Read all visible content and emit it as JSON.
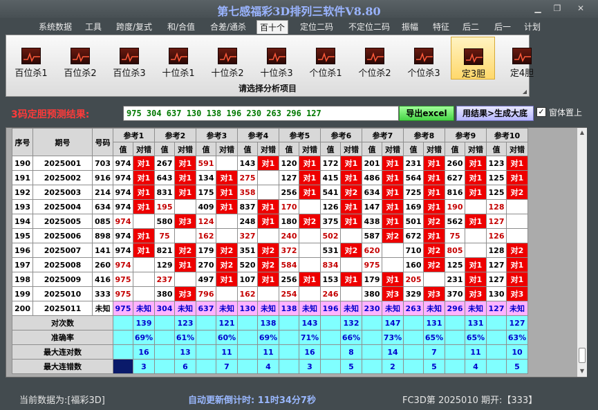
{
  "window": {
    "title": "第七感福彩3D排列三软件V8.80",
    "minimize": "▁",
    "restore": "❐",
    "close": "✕"
  },
  "menu": [
    {
      "label": "系统数据"
    },
    {
      "label": "工具"
    },
    {
      "label": "跨度/复式"
    },
    {
      "label": "和/合值"
    },
    {
      "label": "合差/通杀"
    },
    {
      "label": "百十个"
    },
    {
      "label": "定位二码"
    },
    {
      "label": "不定位二码"
    },
    {
      "label": "振幅"
    },
    {
      "label": "特征"
    },
    {
      "label": "后二"
    },
    {
      "label": "后一"
    },
    {
      "label": "计划"
    }
  ],
  "menu_active": "百十个",
  "ribbon": {
    "buttons": [
      {
        "label": "百位杀1"
      },
      {
        "label": "百位杀2"
      },
      {
        "label": "百位杀3"
      },
      {
        "label": "十位杀1"
      },
      {
        "label": "十位杀2"
      },
      {
        "label": "十位杀3"
      },
      {
        "label": "个位杀1"
      },
      {
        "label": "个位杀2"
      },
      {
        "label": "个位杀3"
      },
      {
        "label": "定3胆"
      },
      {
        "label": "定4胆"
      }
    ],
    "active": "定3胆",
    "caption": "请选择分析项目",
    "icon": "chart-icon"
  },
  "result": {
    "label": "3码定胆预测结果:",
    "value": "975 304 637 130 138 196 230 263 296 127",
    "excel_button": "导出excel",
    "generate_button": "用结果>生成大底",
    "topmost_checked": "✓",
    "topmost_label": "窗体置上"
  },
  "table": {
    "col_seq": "序号",
    "col_issue": "期号",
    "col_number": "号码",
    "ref_headers": [
      "参考1",
      "参考2",
      "参考3",
      "参考4",
      "参考5",
      "参考6",
      "参考7",
      "参考8",
      "参考9",
      "参考10"
    ],
    "sub_value": "值",
    "sub_hit": "对错",
    "rows": [
      {
        "seq": "190",
        "issue": "2025001",
        "number": "703",
        "refs": [
          [
            "974",
            "对1"
          ],
          [
            "267",
            "对1"
          ],
          [
            "591",
            ""
          ],
          [
            "143",
            "对1"
          ],
          [
            "120",
            "对1"
          ],
          [
            "172",
            "对1"
          ],
          [
            "201",
            "对1"
          ],
          [
            "231",
            "对1"
          ],
          [
            "260",
            "对1"
          ],
          [
            "123",
            "对1"
          ]
        ]
      },
      {
        "seq": "191",
        "issue": "2025002",
        "number": "916",
        "refs": [
          [
            "974",
            "对1"
          ],
          [
            "643",
            "对1"
          ],
          [
            "134",
            "对1"
          ],
          [
            "275",
            ""
          ],
          [
            "127",
            "对1"
          ],
          [
            "415",
            "对1"
          ],
          [
            "486",
            "对1"
          ],
          [
            "564",
            "对1"
          ],
          [
            "627",
            "对1"
          ],
          [
            "125",
            "对1"
          ]
        ]
      },
      {
        "seq": "192",
        "issue": "2025003",
        "number": "214",
        "refs": [
          [
            "974",
            "对1"
          ],
          [
            "831",
            "对1"
          ],
          [
            "175",
            "对1"
          ],
          [
            "358",
            ""
          ],
          [
            "256",
            "对1"
          ],
          [
            "541",
            "对2"
          ],
          [
            "634",
            "对1"
          ],
          [
            "725",
            "对1"
          ],
          [
            "816",
            "对1"
          ],
          [
            "125",
            "对2"
          ]
        ]
      },
      {
        "seq": "193",
        "issue": "2025004",
        "number": "634",
        "refs": [
          [
            "974",
            "对1"
          ],
          [
            "195",
            ""
          ],
          [
            "409",
            "对1"
          ],
          [
            "837",
            "对1"
          ],
          [
            "170",
            ""
          ],
          [
            "126",
            "对1"
          ],
          [
            "147",
            "对1"
          ],
          [
            "169",
            "对1"
          ],
          [
            "190",
            ""
          ],
          [
            "128",
            ""
          ]
        ]
      },
      {
        "seq": "194",
        "issue": "2025005",
        "number": "085",
        "refs": [
          [
            "974",
            ""
          ],
          [
            "580",
            "对3"
          ],
          [
            "124",
            ""
          ],
          [
            "248",
            "对1"
          ],
          [
            "180",
            "对2"
          ],
          [
            "375",
            "对1"
          ],
          [
            "438",
            "对1"
          ],
          [
            "501",
            "对2"
          ],
          [
            "562",
            "对1"
          ],
          [
            "127",
            ""
          ]
        ]
      },
      {
        "seq": "195",
        "issue": "2025006",
        "number": "898",
        "refs": [
          [
            "974",
            "对1"
          ],
          [
            "75",
            ""
          ],
          [
            "162",
            ""
          ],
          [
            "327",
            ""
          ],
          [
            "240",
            ""
          ],
          [
            "502",
            ""
          ],
          [
            "587",
            "对2"
          ],
          [
            "672",
            "对1"
          ],
          [
            "75",
            ""
          ],
          [
            "126",
            ""
          ]
        ]
      },
      {
        "seq": "196",
        "issue": "2025007",
        "number": "141",
        "refs": [
          [
            "974",
            "对1"
          ],
          [
            "821",
            "对2"
          ],
          [
            "179",
            "对2"
          ],
          [
            "351",
            "对2"
          ],
          [
            "372",
            ""
          ],
          [
            "531",
            "对2"
          ],
          [
            "620",
            ""
          ],
          [
            "710",
            "对2"
          ],
          [
            "805",
            ""
          ],
          [
            "128",
            "对2"
          ]
        ]
      },
      {
        "seq": "197",
        "issue": "2025008",
        "number": "260",
        "refs": [
          [
            "974",
            ""
          ],
          [
            "129",
            "对1"
          ],
          [
            "270",
            "对2"
          ],
          [
            "520",
            "对2"
          ],
          [
            "584",
            ""
          ],
          [
            "834",
            ""
          ],
          [
            "975",
            ""
          ],
          [
            "160",
            "对2"
          ],
          [
            "125",
            "对1"
          ],
          [
            "127",
            "对1"
          ]
        ]
      },
      {
        "seq": "198",
        "issue": "2025009",
        "number": "416",
        "refs": [
          [
            "975",
            ""
          ],
          [
            "237",
            ""
          ],
          [
            "497",
            "对1"
          ],
          [
            "107",
            "对1"
          ],
          [
            "256",
            "对1"
          ],
          [
            "153",
            "对1"
          ],
          [
            "179",
            "对1"
          ],
          [
            "205",
            ""
          ],
          [
            "231",
            "对1"
          ],
          [
            "127",
            "对1"
          ]
        ]
      },
      {
        "seq": "199",
        "issue": "2025010",
        "number": "333",
        "refs": [
          [
            "975",
            ""
          ],
          [
            "380",
            "对3"
          ],
          [
            "796",
            ""
          ],
          [
            "162",
            ""
          ],
          [
            "254",
            ""
          ],
          [
            "246",
            ""
          ],
          [
            "380",
            "对3"
          ],
          [
            "329",
            "对3"
          ],
          [
            "370",
            "对3"
          ],
          [
            "130",
            "对3"
          ]
        ]
      }
    ],
    "prediction": {
      "seq": "200",
      "issue": "2025011",
      "number": "未知",
      "values": [
        "975",
        "304",
        "637",
        "130",
        "138",
        "196",
        "230",
        "263",
        "296",
        "127"
      ],
      "unknown": "未知"
    },
    "stats": [
      {
        "label": "对次数",
        "values": [
          "139",
          "123",
          "121",
          "138",
          "143",
          "132",
          "147",
          "131",
          "131",
          "127"
        ]
      },
      {
        "label": "准确率",
        "values": [
          "69%",
          "61%",
          "60%",
          "69%",
          "71%",
          "66%",
          "73%",
          "65%",
          "65%",
          "63%"
        ]
      },
      {
        "label": "最大连对数",
        "values": [
          "16",
          "13",
          "11",
          "11",
          "16",
          "8",
          "14",
          "7",
          "11",
          "10"
        ]
      },
      {
        "label": "最大连错数",
        "values": [
          "3",
          "6",
          "7",
          "4",
          "3",
          "5",
          "2",
          "5",
          "4",
          "5"
        ]
      }
    ]
  },
  "status": {
    "data_source": "当前数据为:[福彩3D]",
    "countdown": "自动更新倒计时: 11时34分7秒",
    "issue_info": "FC3D第 2025010 期开:【333】"
  }
}
